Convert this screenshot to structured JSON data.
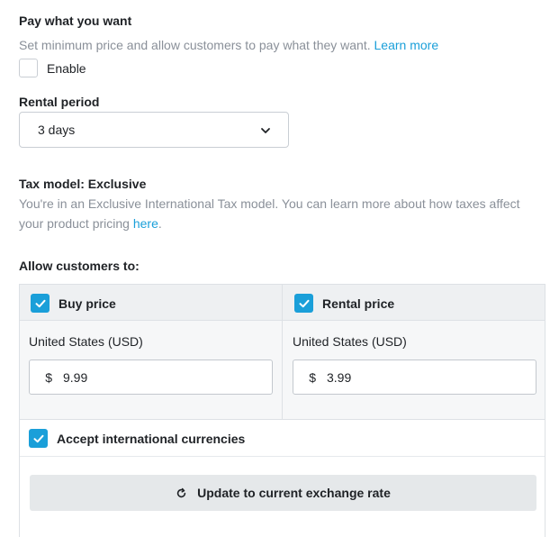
{
  "pay_what_you_want": {
    "title": "Pay what you want",
    "description": "Set minimum price and allow customers to pay what they want.",
    "learn_more": "Learn more",
    "enable_label": "Enable"
  },
  "rental_period": {
    "title": "Rental period",
    "selected": "3 days"
  },
  "tax_model": {
    "title": "Tax model: Exclusive",
    "description": "You're in an Exclusive International Tax model. You can learn more about how taxes affect your product pricing",
    "link": "here",
    "trailing": "."
  },
  "allow": {
    "title": "Allow customers to:",
    "buy": {
      "label": "Buy price",
      "country": "United States (USD)",
      "currency_symbol": "$",
      "amount": "9.99",
      "checked": true
    },
    "rental": {
      "label": "Rental price",
      "country": "United States (USD)",
      "currency_symbol": "$",
      "amount": "3.99",
      "checked": true
    },
    "international": {
      "label": "Accept international currencies",
      "checked": true
    },
    "update_button": "Update to current exchange rate"
  },
  "colors": {
    "accent": "#1a9fd9",
    "text": "#1f2226",
    "muted": "#8a9099"
  }
}
